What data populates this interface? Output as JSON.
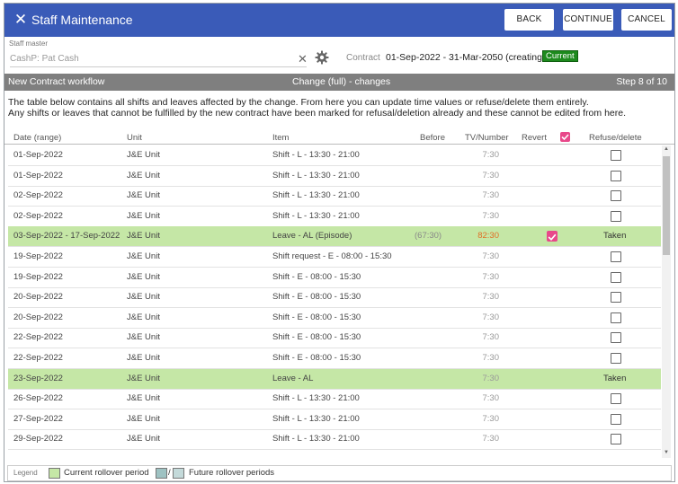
{
  "window": {
    "title": "Staff Maintenance",
    "buttons": {
      "back": "BACK",
      "continue": "CONTINUE",
      "cancel": "CANCEL"
    }
  },
  "staff": {
    "label": "Staff master",
    "value": "CashP: Pat Cash",
    "contract_label": "Contract",
    "contract_value": "01-Sep-2022 - 31-Mar-2050 (creating)",
    "badge": "Current"
  },
  "workflow": {
    "left": "New Contract workflow",
    "center": "Change (full) - changes",
    "right": "Step 8 of 10"
  },
  "description": {
    "line1": "The table below contains all shifts and leaves affected by the change. From here you can update time values or refuse/delete them entirely.",
    "line2": "Any shifts or leaves that cannot be fulfilled by the new contract have been marked for refusal/deletion already and these cannot be edited from here."
  },
  "table": {
    "headers": {
      "date": "Date (range)",
      "unit": "Unit",
      "item": "Item",
      "before": "Before",
      "tv": "TV/Number",
      "revert": "Revert",
      "refuse": "Refuse/delete"
    },
    "rows": [
      {
        "date": "01-Sep-2022",
        "unit": "J&E Unit",
        "item": "Shift - L - 13:30 - 21:00",
        "before": "",
        "tv": "7:30",
        "taken": ""
      },
      {
        "date": "01-Sep-2022",
        "unit": "J&E Unit",
        "item": "Shift - L - 13:30 - 21:00",
        "before": "",
        "tv": "7:30",
        "taken": ""
      },
      {
        "date": "02-Sep-2022",
        "unit": "J&E Unit",
        "item": "Shift - L - 13:30 - 21:00",
        "before": "",
        "tv": "7:30",
        "taken": ""
      },
      {
        "date": "02-Sep-2022",
        "unit": "J&E Unit",
        "item": "Shift - L - 13:30 - 21:00",
        "before": "",
        "tv": "7:30",
        "taken": ""
      },
      {
        "date": "03-Sep-2022 - 17-Sep-2022",
        "unit": "J&E Unit",
        "item": "Leave - AL (Episode)",
        "before": "(67:30)",
        "tv": "82:30",
        "taken": "Taken"
      },
      {
        "date": "19-Sep-2022",
        "unit": "J&E Unit",
        "item": "Shift request - E - 08:00 - 15:30",
        "before": "",
        "tv": "7:30",
        "taken": ""
      },
      {
        "date": "19-Sep-2022",
        "unit": "J&E Unit",
        "item": "Shift - E - 08:00 - 15:30",
        "before": "",
        "tv": "7:30",
        "taken": ""
      },
      {
        "date": "20-Sep-2022",
        "unit": "J&E Unit",
        "item": "Shift - E - 08:00 - 15:30",
        "before": "",
        "tv": "7:30",
        "taken": ""
      },
      {
        "date": "20-Sep-2022",
        "unit": "J&E Unit",
        "item": "Shift - E - 08:00 - 15:30",
        "before": "",
        "tv": "7:30",
        "taken": ""
      },
      {
        "date": "22-Sep-2022",
        "unit": "J&E Unit",
        "item": "Shift - E - 08:00 - 15:30",
        "before": "",
        "tv": "7:30",
        "taken": ""
      },
      {
        "date": "22-Sep-2022",
        "unit": "J&E Unit",
        "item": "Shift - E - 08:00 - 15:30",
        "before": "",
        "tv": "7:30",
        "taken": ""
      },
      {
        "date": "23-Sep-2022",
        "unit": "J&E Unit",
        "item": "Leave - AL",
        "before": "",
        "tv": "7:30",
        "taken": "Taken"
      },
      {
        "date": "26-Sep-2022",
        "unit": "J&E Unit",
        "item": "Shift - L - 13:30 - 21:00",
        "before": "",
        "tv": "7:30",
        "taken": ""
      },
      {
        "date": "27-Sep-2022",
        "unit": "J&E Unit",
        "item": "Shift - L - 13:30 - 21:00",
        "before": "",
        "tv": "7:30",
        "taken": ""
      },
      {
        "date": "29-Sep-2022",
        "unit": "J&E Unit",
        "item": "Shift - L - 13:30 - 21:00",
        "before": "",
        "tv": "7:30",
        "taken": ""
      }
    ]
  },
  "legend": {
    "label": "Legend",
    "current": "Current rollover period",
    "separator": "/",
    "future": "Future rollover periods"
  },
  "colors": {
    "titlebar": "#3a5bb8",
    "current_period": "#c5e7a6",
    "checkbox_checked": "#e8488a",
    "badge": "#1d8a1d",
    "highlight_value": "#e06f26"
  },
  "icons": {
    "close": "close-icon",
    "clear": "clear-icon",
    "settings": "gear-icon"
  }
}
